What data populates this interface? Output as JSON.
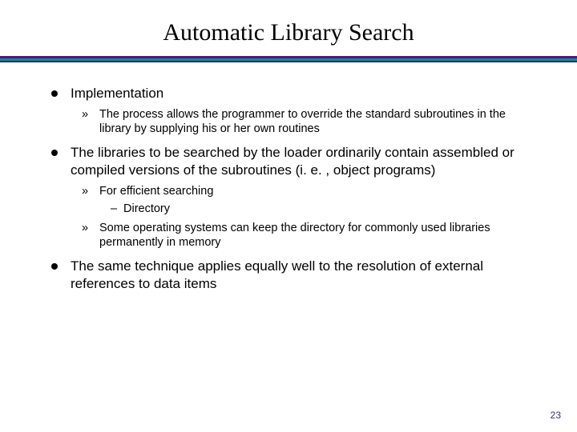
{
  "title": "Automatic Library Search",
  "bullets": [
    {
      "text": "Implementation",
      "sub": [
        {
          "text": "The process allows the programmer to override the standard subroutines in the library by supplying his or her own routines"
        }
      ]
    },
    {
      "text": "The libraries to be searched by the loader ordinarily contain assembled or compiled versions of the subroutines (i. e. , object programs)",
      "sub": [
        {
          "text": "For efficient searching",
          "sub": [
            {
              "text": "Directory"
            }
          ]
        },
        {
          "text": "Some operating systems can keep the directory for commonly used libraries permanently in memory"
        }
      ]
    },
    {
      "text": "The same technique applies equally well to the resolution of external references to data items"
    }
  ],
  "page_number": "23"
}
